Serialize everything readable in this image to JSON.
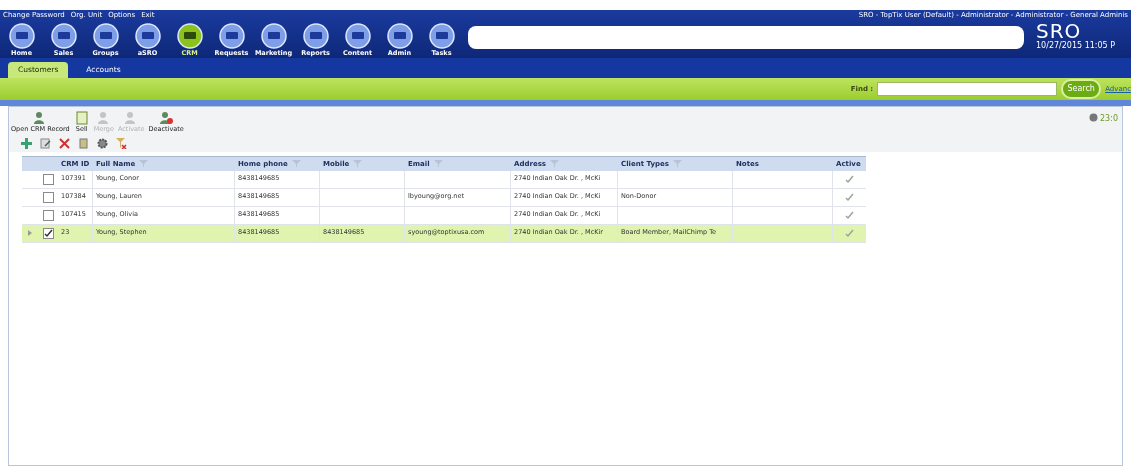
{
  "top_links": [
    "Change Password",
    "Org. Unit",
    "Options",
    "Exit"
  ],
  "nav": [
    {
      "label": "Home",
      "selected": false
    },
    {
      "label": "Sales",
      "selected": false
    },
    {
      "label": "Groups",
      "selected": false
    },
    {
      "label": "aSRO",
      "selected": false
    },
    {
      "label": "CRM",
      "selected": true
    },
    {
      "label": "Requests",
      "selected": false
    },
    {
      "label": "Marketing",
      "selected": false
    },
    {
      "label": "Reports",
      "selected": false
    },
    {
      "label": "Content",
      "selected": false
    },
    {
      "label": "Admin",
      "selected": false
    },
    {
      "label": "Tasks",
      "selected": false
    }
  ],
  "user_info": "SRO - TopTix User (Default) - Administrator - Administrator - General Adminis",
  "logo": "SRO",
  "datetime": "10/27/2015 11:05 P",
  "tabs": [
    {
      "label": "Customers",
      "selected": true
    },
    {
      "label": "Accounts",
      "selected": false
    }
  ],
  "find": {
    "label": "Find :",
    "button": "Search",
    "advanced": "Advanc"
  },
  "toolbar": [
    {
      "label": "Open CRM Record",
      "disabled": false
    },
    {
      "label": "Sell",
      "disabled": false
    },
    {
      "label": "Merge",
      "disabled": true
    },
    {
      "label": "Activate",
      "disabled": true
    },
    {
      "label": "Deactivate",
      "disabled": false
    }
  ],
  "time_note": "23:0",
  "table": {
    "columns": [
      {
        "label": "CRM ID",
        "filter": false
      },
      {
        "label": "Full Name",
        "filter": true
      },
      {
        "label": "Home phone",
        "filter": true
      },
      {
        "label": "Mobile",
        "filter": true
      },
      {
        "label": "Email",
        "filter": true
      },
      {
        "label": "Address",
        "filter": true
      },
      {
        "label": "Client Types",
        "filter": true
      },
      {
        "label": "Notes",
        "filter": false
      },
      {
        "label": "Active",
        "filter": false
      }
    ],
    "rows": [
      {
        "selected": false,
        "checked": false,
        "active": true,
        "cells": [
          "107391",
          "Young, Conor",
          "8438149685",
          "",
          "",
          "2740 Indian Oak Dr. , McKi",
          "",
          ""
        ]
      },
      {
        "selected": false,
        "checked": false,
        "active": true,
        "cells": [
          "107384",
          "Young, Lauren",
          "8438149685",
          "",
          "lbyoung@org.net",
          "2740 Indian Oak Dr. , McKi",
          "Non-Donor",
          ""
        ]
      },
      {
        "selected": false,
        "checked": false,
        "active": true,
        "cells": [
          "107415",
          "Young, Olivia",
          "8438149685",
          "",
          "",
          "2740 Indian Oak Dr. , McKi",
          "",
          ""
        ]
      },
      {
        "selected": true,
        "checked": true,
        "active": true,
        "cells": [
          "23",
          "Young, Stephen",
          "8438149685",
          "8438149685",
          "syoung@toptixusa.com",
          "2740 Indian Oak Dr. , McKir",
          "Board Member, MailChimp Te",
          ""
        ]
      }
    ]
  }
}
